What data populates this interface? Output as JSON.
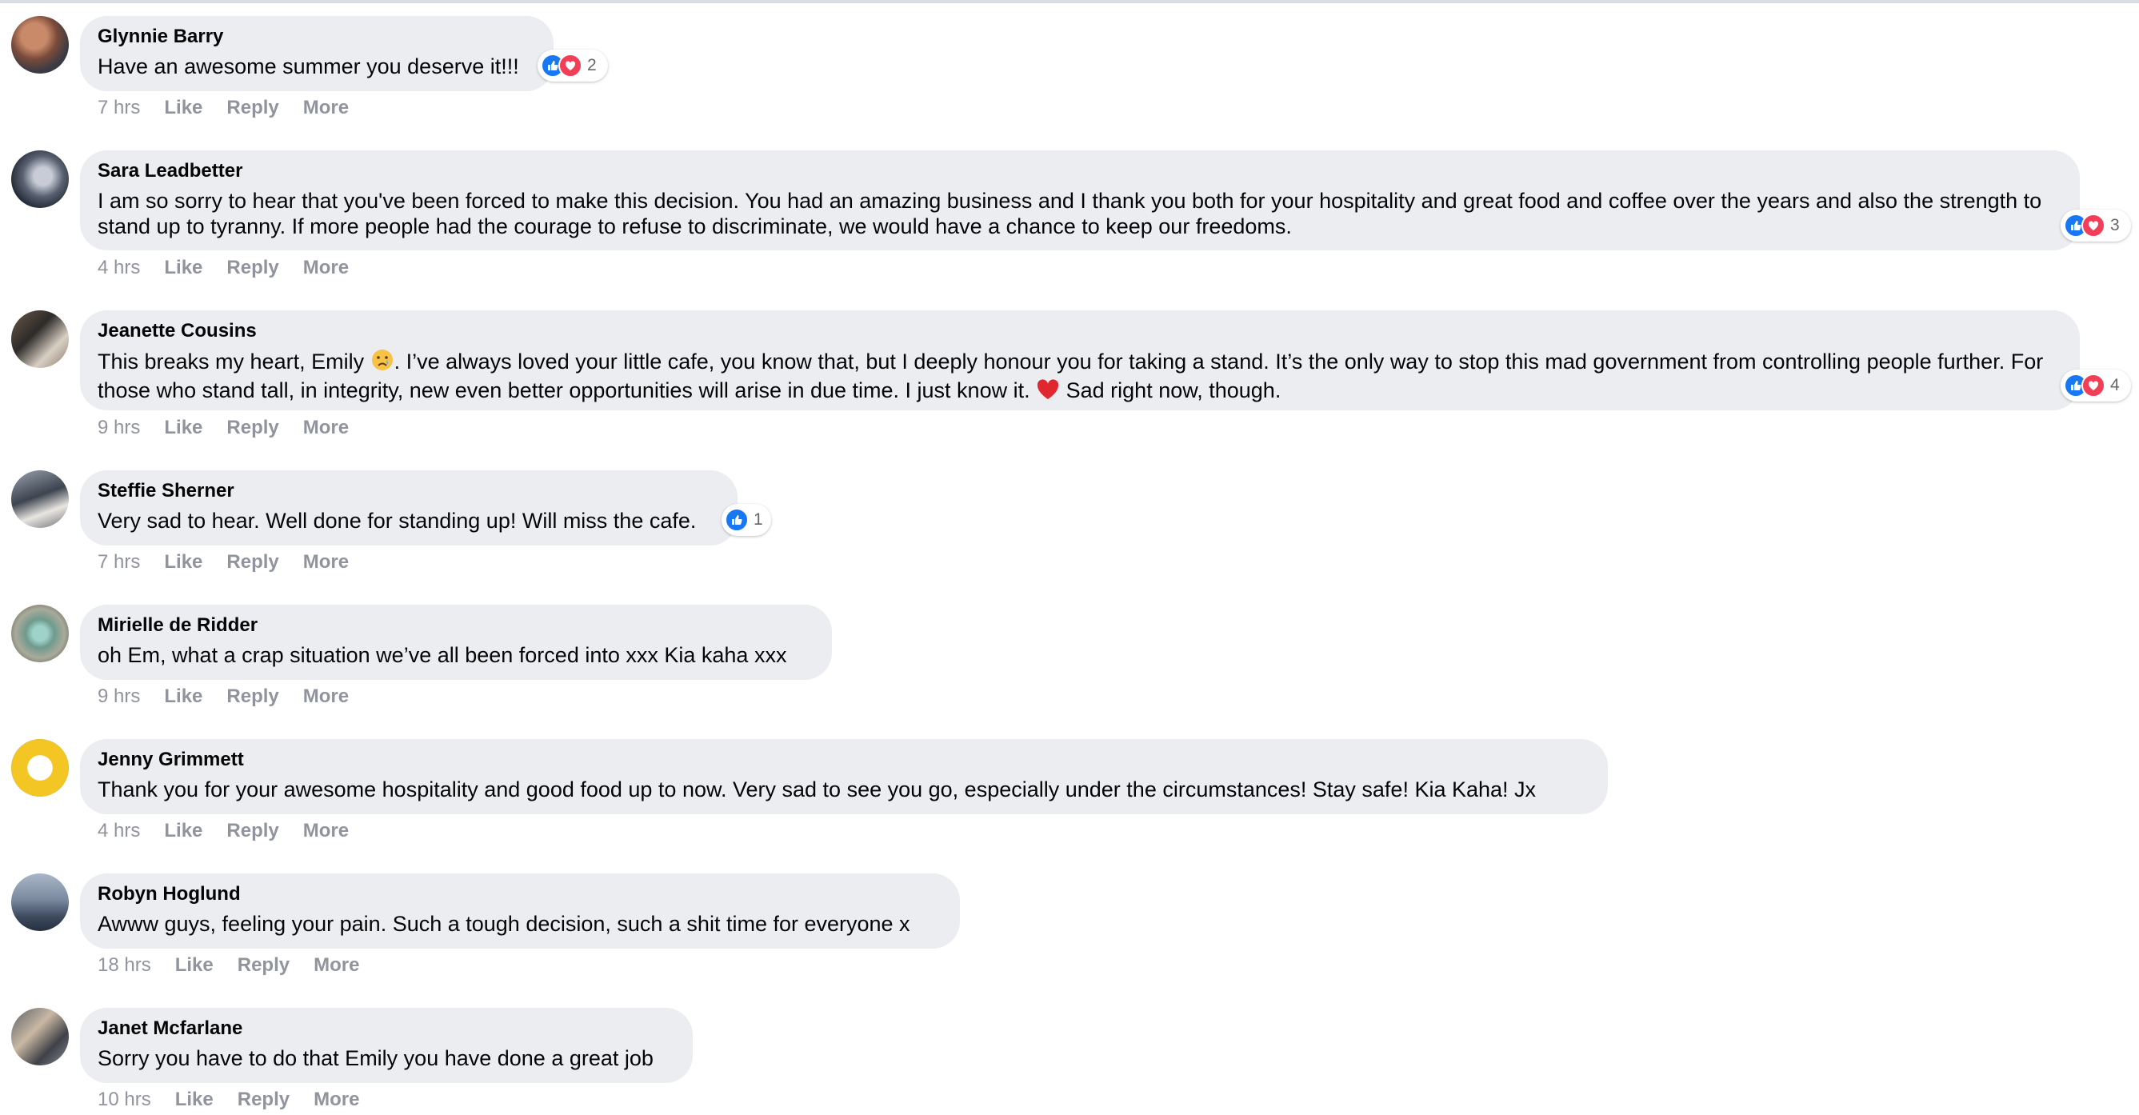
{
  "comments": [
    {
      "author": "Glynnie Barry",
      "text": "Have an awesome summer you deserve it!!!",
      "time": "7 hrs",
      "like": "Like",
      "reply": "Reply",
      "more": "More",
      "reaction_count": "2"
    },
    {
      "author": "Sara Leadbetter",
      "text": "I am so sorry to hear that you've been forced to make this decision. You had an amazing business and I thank you both for your hospitality and great food and coffee over the years and also the strength to stand up to tyranny. If more people had the courage to refuse to discriminate, we would have a chance to keep our freedoms.",
      "time": "4 hrs",
      "like": "Like",
      "reply": "Reply",
      "more": "More",
      "reaction_count": "3"
    },
    {
      "author": "Jeanette Cousins",
      "text_a": "This breaks my heart, Emily",
      "text_b": ". I’ve always loved your little cafe, you know that, but I deeply honour you for taking a stand. It’s the only way to stop this mad government from controlling people further. For those who stand tall, in integrity, new even better opportunities will arise in due time. I just know it.",
      "text_c": "Sad right now, though.",
      "time": "9 hrs",
      "like": "Like",
      "reply": "Reply",
      "more": "More",
      "reaction_count": "4"
    },
    {
      "author": "Steffie Sherner",
      "text": "Very sad to hear. Well done for standing up! Will miss the cafe.",
      "time": "7 hrs",
      "like": "Like",
      "reply": "Reply",
      "more": "More",
      "reaction_count": "1"
    },
    {
      "author": "Mirielle de Ridder",
      "text": "oh Em, what a crap situation we’ve all been forced into xxx Kia kaha xxx",
      "time": "9 hrs",
      "like": "Like",
      "reply": "Reply",
      "more": "More"
    },
    {
      "author": "Jenny Grimmett",
      "text": "Thank you for your awesome hospitality and good food up to now. Very sad to see you go, especially under the circumstances! Stay safe! Kia Kaha! Jx",
      "time": "4 hrs",
      "like": "Like",
      "reply": "Reply",
      "more": "More"
    },
    {
      "author": "Robyn Hoglund",
      "text": "Awww guys, feeling your pain. Such a tough decision, such a shit time for everyone x",
      "time": "18 hrs",
      "like": "Like",
      "reply": "Reply",
      "more": "More"
    },
    {
      "author": "Janet Mcfarlane",
      "text": "Sorry you have to do that Emily you have done a great job",
      "time": "10 hrs",
      "like": "Like",
      "reply": "Reply",
      "more": "More"
    }
  ],
  "colors": {
    "bubble": "#ebedf0",
    "meta": "#90949c",
    "like": "#1877f2",
    "love": "#f33e58"
  }
}
